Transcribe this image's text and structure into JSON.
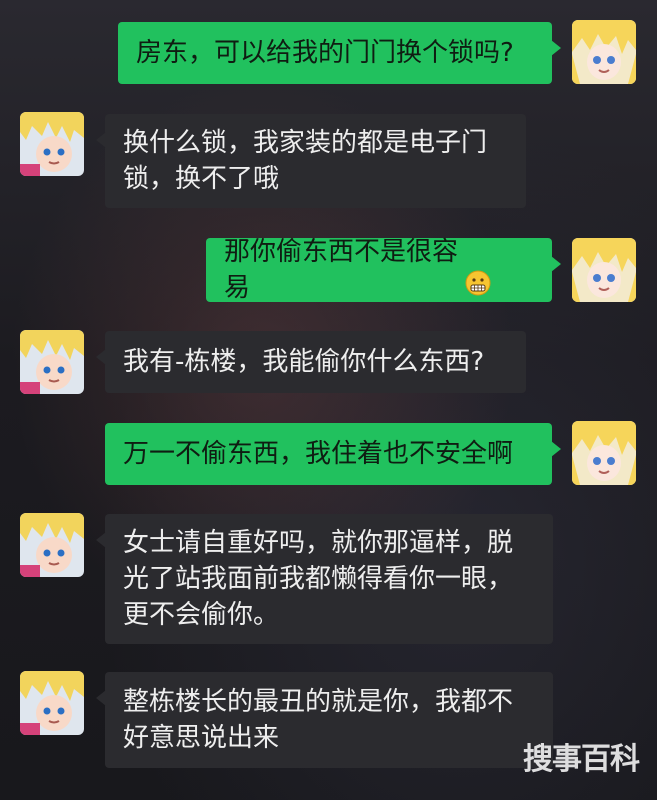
{
  "messages": [
    {
      "side": "out",
      "text": "房东，可以给我的门门换个锁吗?"
    },
    {
      "side": "in",
      "text": "换什么锁，我家装的都是电子门\n锁，换不了哦"
    },
    {
      "side": "out",
      "text": "那你偷东西不是很容易",
      "emoji": "grimace-emoji"
    },
    {
      "side": "in",
      "text": "我有-栋楼，我能偷你什么东西?"
    },
    {
      "side": "out",
      "text": "万一不偷东西，我住着也不安全啊"
    },
    {
      "side": "in",
      "text": "女士请自重好吗，就你那逼样，脱\n光了站我面前我都懒得看你一眼，\n更不会偷你。"
    },
    {
      "side": "in",
      "text": "整栋楼长的最丑的就是你，我都不\n好意思说出来"
    }
  ],
  "watermark": "搜事百科",
  "colors": {
    "outgoing_bubble": "#21c15e",
    "incoming_bubble": "#2b2b2f",
    "background": "#1c1b20"
  }
}
